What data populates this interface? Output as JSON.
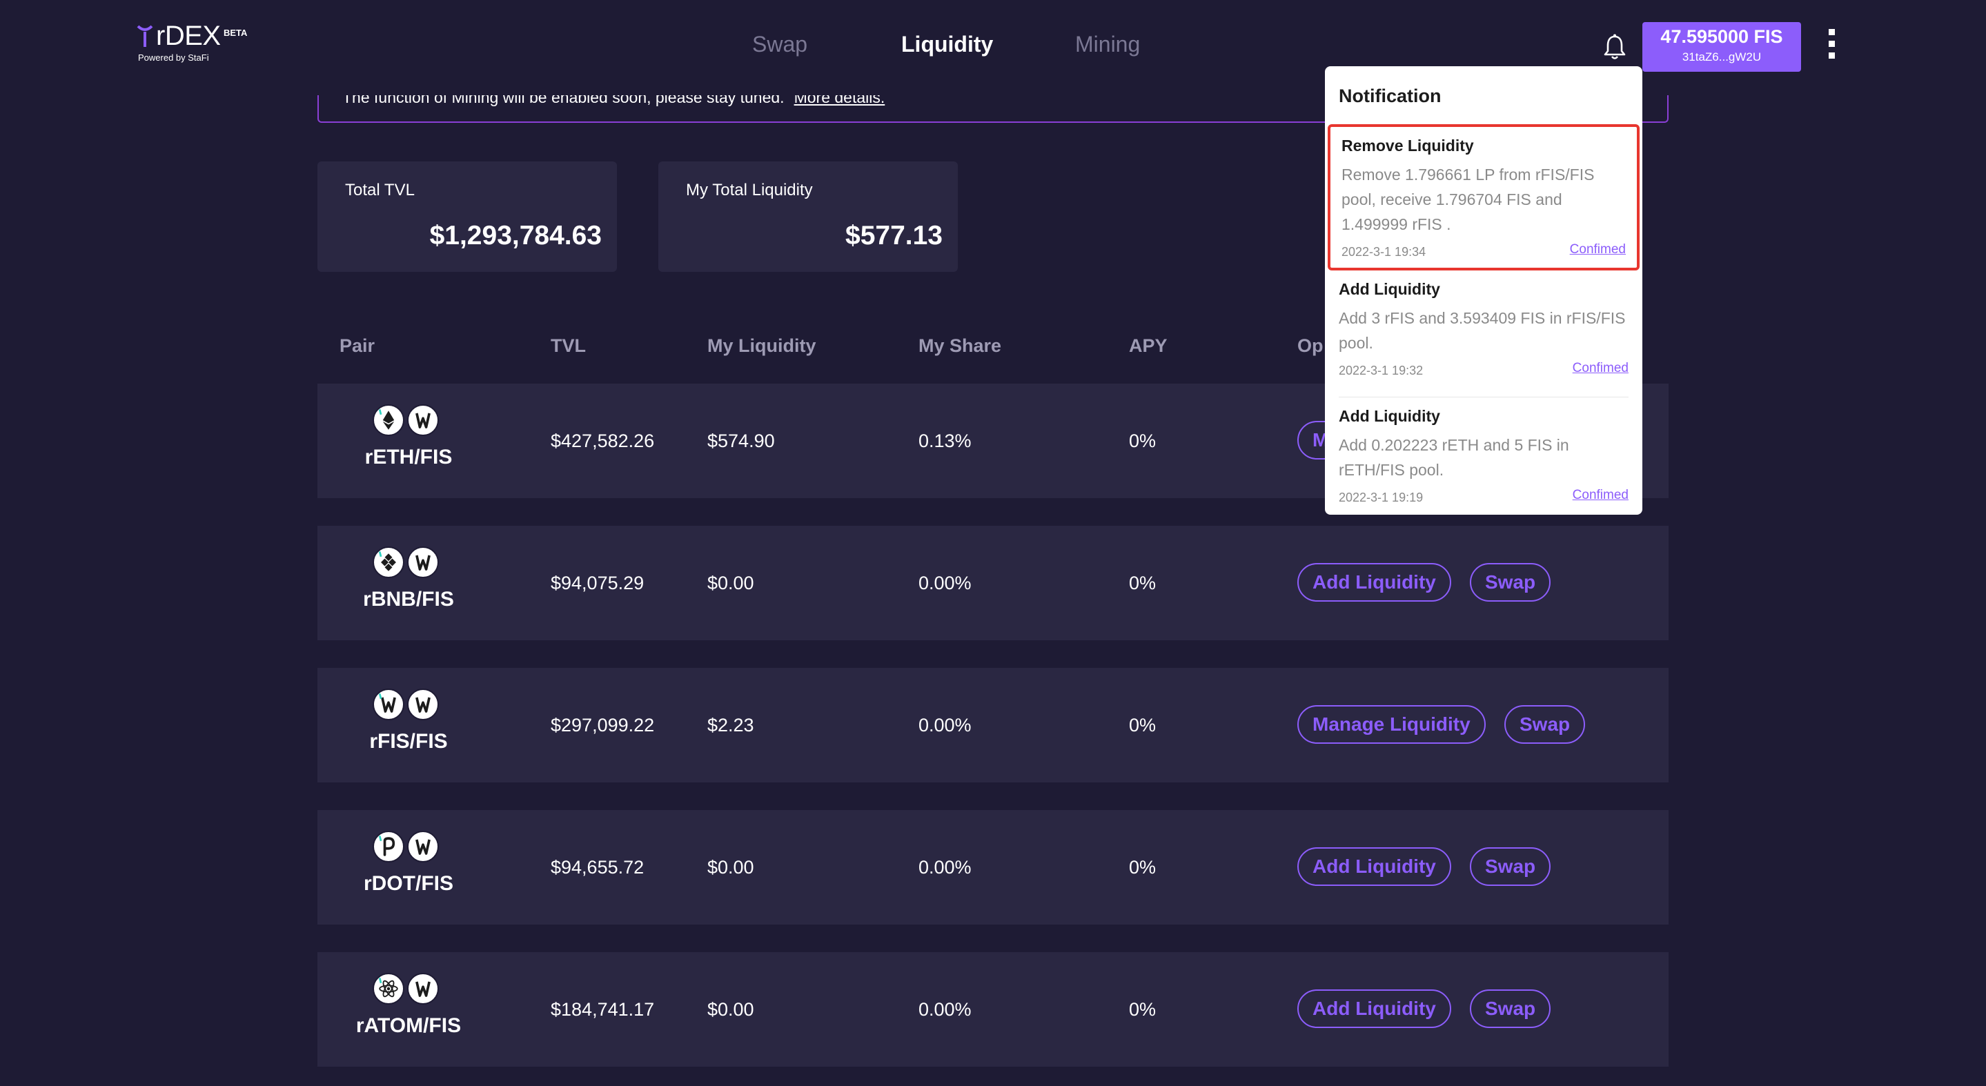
{
  "header": {
    "logo_name": "rDEX",
    "logo_badge": "BETA",
    "logo_sub": "Powered by StaFi",
    "nav": [
      "Swap",
      "Liquidity",
      "Mining"
    ],
    "active_nav": "Liquidity",
    "balance_amount": "47.595000 FIS",
    "balance_address": "31taZ6...gW2U"
  },
  "banner": {
    "text": "The function of Mining will be enabled soon, please stay tuned.",
    "link": "More details."
  },
  "stats": {
    "total_tvl_label": "Total TVL",
    "total_tvl_value": "$1,293,784.63",
    "my_liquidity_label": "My Total Liquidity",
    "my_liquidity_value": "$577.13"
  },
  "table": {
    "headers": [
      "Pair",
      "TVL",
      "My Liquidity",
      "My Share",
      "APY",
      "Op"
    ],
    "rows": [
      {
        "pair": "rETH/FIS",
        "tvl": "$427,582.26",
        "my_liquidity": "$574.90",
        "my_share": "0.13%",
        "apy": "0%",
        "action": "M",
        "swap": ""
      },
      {
        "pair": "rBNB/FIS",
        "tvl": "$94,075.29",
        "my_liquidity": "$0.00",
        "my_share": "0.00%",
        "apy": "0%",
        "action": "Add Liquidity",
        "swap": "Swap"
      },
      {
        "pair": "rFIS/FIS",
        "tvl": "$297,099.22",
        "my_liquidity": "$2.23",
        "my_share": "0.00%",
        "apy": "0%",
        "action": "Manage Liquidity",
        "swap": "Swap"
      },
      {
        "pair": "rDOT/FIS",
        "tvl": "$94,655.72",
        "my_liquidity": "$0.00",
        "my_share": "0.00%",
        "apy": "0%",
        "action": "Add Liquidity",
        "swap": "Swap"
      },
      {
        "pair": "rATOM/FIS",
        "tvl": "$184,741.17",
        "my_liquidity": "$0.00",
        "my_share": "0.00%",
        "apy": "0%",
        "action": "Add Liquidity",
        "swap": "Swap"
      }
    ]
  },
  "notification": {
    "title": "Notification",
    "items": [
      {
        "title": "Remove Liquidity",
        "body": "Remove 1.796661 LP from rFIS/FIS pool, receive 1.796704 FIS and 1.499999 rFIS .",
        "date": "2022-3-1 19:34",
        "status": "Confimed"
      },
      {
        "title": "Add Liquidity",
        "body": "Add 3 rFIS and 3.593409 FIS in rFIS/FIS pool.",
        "date": "2022-3-1 19:32",
        "status": "Confimed"
      },
      {
        "title": "Add Liquidity",
        "body": "Add 0.202223 rETH and 5 FIS in rETH/FIS pool.",
        "date": "2022-3-1 19:19",
        "status": "Confimed"
      }
    ]
  },
  "colors": {
    "background": "#1e1b34",
    "card": "#2a2742",
    "accent": "#8c5dfb",
    "highlight_border": "#e8362f"
  },
  "icons": [
    "logo-mark-icon",
    "bell-icon",
    "more-vertical-icon",
    "reth-token-icon",
    "rbnb-token-icon",
    "rfis-token-icon",
    "rdot-token-icon",
    "ratom-token-icon",
    "fis-token-icon"
  ]
}
